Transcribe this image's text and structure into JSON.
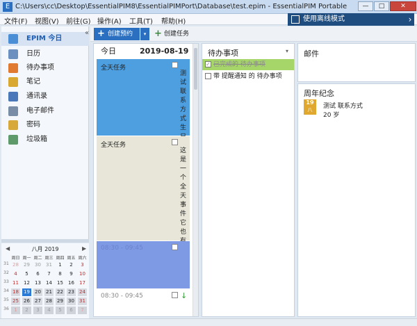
{
  "window": {
    "title": "C:\\Users\\cc\\Desktop\\EssentialPIM8\\EssentialPIMPort\\Database\\test.epim - EssentialPIM Portable",
    "min": "—",
    "max": "□",
    "close": "✕"
  },
  "menu": [
    "文件(F)",
    "视图(V)",
    "前往(G)",
    "操作(A)",
    "工具(T)",
    "帮助(H)"
  ],
  "offline": {
    "label": "使用离线模式",
    "arrow": "›"
  },
  "sidebar": {
    "collapse": "«",
    "items": [
      {
        "label": "EPIM 今日",
        "icon": "home-icon",
        "color": "#4a8fd6"
      },
      {
        "label": "日历",
        "icon": "calendar-icon",
        "color": "#6b8fbf"
      },
      {
        "label": "待办事项",
        "icon": "checklist-icon",
        "color": "#e07a30"
      },
      {
        "label": "笔记",
        "icon": "note-icon",
        "color": "#d9a830"
      },
      {
        "label": "通讯录",
        "icon": "contacts-icon",
        "color": "#4a78b8"
      },
      {
        "label": "电子邮件",
        "icon": "mail-icon",
        "color": "#7a8da6"
      },
      {
        "label": "密码",
        "icon": "key-icon",
        "color": "#d6a93a"
      },
      {
        "label": "垃圾箱",
        "icon": "trash-icon",
        "color": "#5e9a6a"
      }
    ]
  },
  "minical": {
    "month": "八月  2019",
    "prev": "◀",
    "next": "▶",
    "dow": [
      "周日",
      "周一",
      "周二",
      "周三",
      "周四",
      "周五",
      "周六"
    ],
    "weeks": [
      {
        "wk": "31",
        "days": [
          "28",
          "29",
          "30",
          "31",
          "1",
          "2",
          "3"
        ]
      },
      {
        "wk": "32",
        "days": [
          "4",
          "5",
          "6",
          "7",
          "8",
          "9",
          "10"
        ]
      },
      {
        "wk": "33",
        "days": [
          "11",
          "12",
          "13",
          "14",
          "15",
          "16",
          "17"
        ]
      },
      {
        "wk": "34",
        "days": [
          "18",
          "19",
          "20",
          "21",
          "22",
          "23",
          "24"
        ]
      },
      {
        "wk": "35",
        "days": [
          "25",
          "26",
          "27",
          "28",
          "29",
          "30",
          "31"
        ]
      },
      {
        "wk": "36",
        "days": [
          "1",
          "2",
          "3",
          "4",
          "5",
          "6",
          "7"
        ]
      }
    ]
  },
  "toolbar": {
    "new_appt": "创建预约",
    "new_task": "创建任务",
    "plus": "+",
    "dropdown": "▾"
  },
  "today": {
    "title": "今日",
    "date": "2019-08-19",
    "events": [
      {
        "label": "全天任务",
        "text": "测试联系方式生日",
        "color": "#4e9fe0"
      },
      {
        "label": "全天任务",
        "text": "这是一个全天事件它也有",
        "color": "#e7e6d8"
      },
      {
        "label": "08:30 - 09:45",
        "text": "",
        "color": "#7f9ae4"
      },
      {
        "label": "08:30 - 09:45",
        "text": "↓",
        "color": "#ffffff"
      }
    ]
  },
  "tasks": {
    "title": "待办事项",
    "dropdown": "▾",
    "items": [
      {
        "text": "已完成的 待办事项",
        "done": true,
        "check": "✓"
      },
      {
        "text": "带 提醒通知 的 待办事项",
        "done": false,
        "check": ""
      }
    ]
  },
  "mail": {
    "title": "邮件"
  },
  "anniversary": {
    "title": "周年纪念",
    "icon_day": "19",
    "icon_month": "八",
    "name": "测试 联系方式",
    "age": "20 岁"
  }
}
